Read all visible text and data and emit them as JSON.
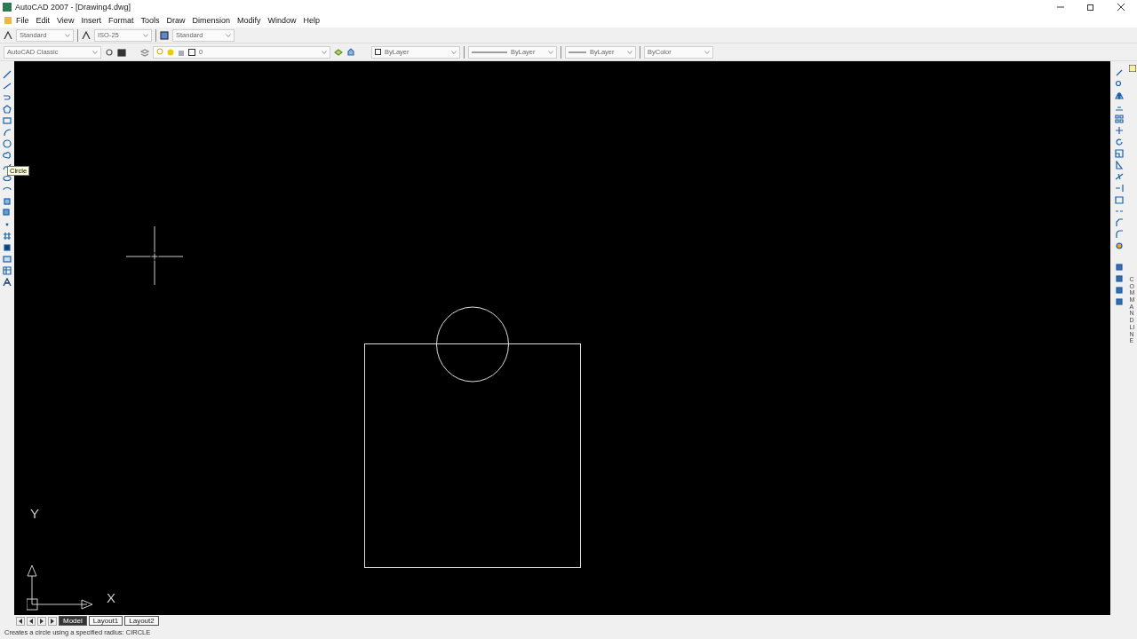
{
  "window": {
    "title": "AutoCAD 2007 - [Drawing4.dwg]"
  },
  "menu": [
    "File",
    "Edit",
    "View",
    "Insert",
    "Format",
    "Tools",
    "Draw",
    "Dimension",
    "Modify",
    "Window",
    "Help"
  ],
  "styles_toolbar": [
    {
      "kind": "text",
      "value": "Standard"
    },
    {
      "kind": "dim",
      "value": "ISO-25"
    },
    {
      "kind": "table",
      "value": "Standard"
    }
  ],
  "workspace": {
    "value": "AutoCAD Classic"
  },
  "layer": {
    "value": "0"
  },
  "properties": [
    {
      "kind": "color",
      "value": "ByLayer"
    },
    {
      "kind": "linetype",
      "value": "ByLayer"
    },
    {
      "kind": "lineweight",
      "value": "ByLayer"
    },
    {
      "kind": "plain",
      "value": "ByColor"
    }
  ],
  "tooltip": {
    "text": "Circle"
  },
  "ucs": {
    "x_label": "X",
    "y_label": "Y"
  },
  "side_panel": {
    "title": "COMMAND LINE"
  },
  "layout_tabs": [
    {
      "label": "Model",
      "selected": true
    },
    {
      "label": "Layout1",
      "selected": false
    },
    {
      "label": "Layout2",
      "selected": false
    }
  ],
  "status_bar": {
    "text": "Creates a circle using a specified radius:  CIRCLE"
  }
}
